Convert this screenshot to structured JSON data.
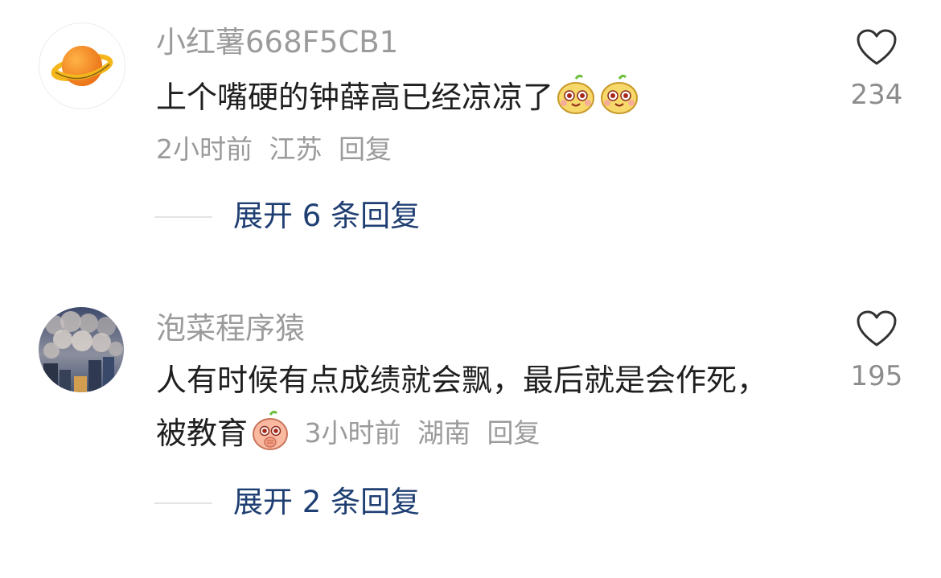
{
  "comments": [
    {
      "username": "小红薯668F5CB1",
      "text": "上个嘴硬的钟薛高已经凉凉了",
      "emojis": [
        "smiling-face-emoji",
        "smiling-face-emoji"
      ],
      "time": "2小时前",
      "location": "江苏",
      "reply_label": "回复",
      "likes": "234",
      "expand_label": "展开 6 条回复",
      "avatar_icon": "orange-planet-icon"
    },
    {
      "username": "泡菜程序猿",
      "text": "人有时候有点成绩就会飘，最后就是会作死，被教育",
      "emojis": [
        "thinking-face-emoji"
      ],
      "time": "3小时前",
      "location": "湖南",
      "reply_label": "回复",
      "likes": "195",
      "expand_label": "展开 2 条回复",
      "avatar_icon": "cloudy-sky-photo"
    }
  ],
  "colors": {
    "username": "#9b9b9b",
    "text": "#1f1f1f",
    "meta": "#9b9b9b",
    "expand": "#1f3f73",
    "divider": "#e3e3e3",
    "heart": "#333333"
  }
}
